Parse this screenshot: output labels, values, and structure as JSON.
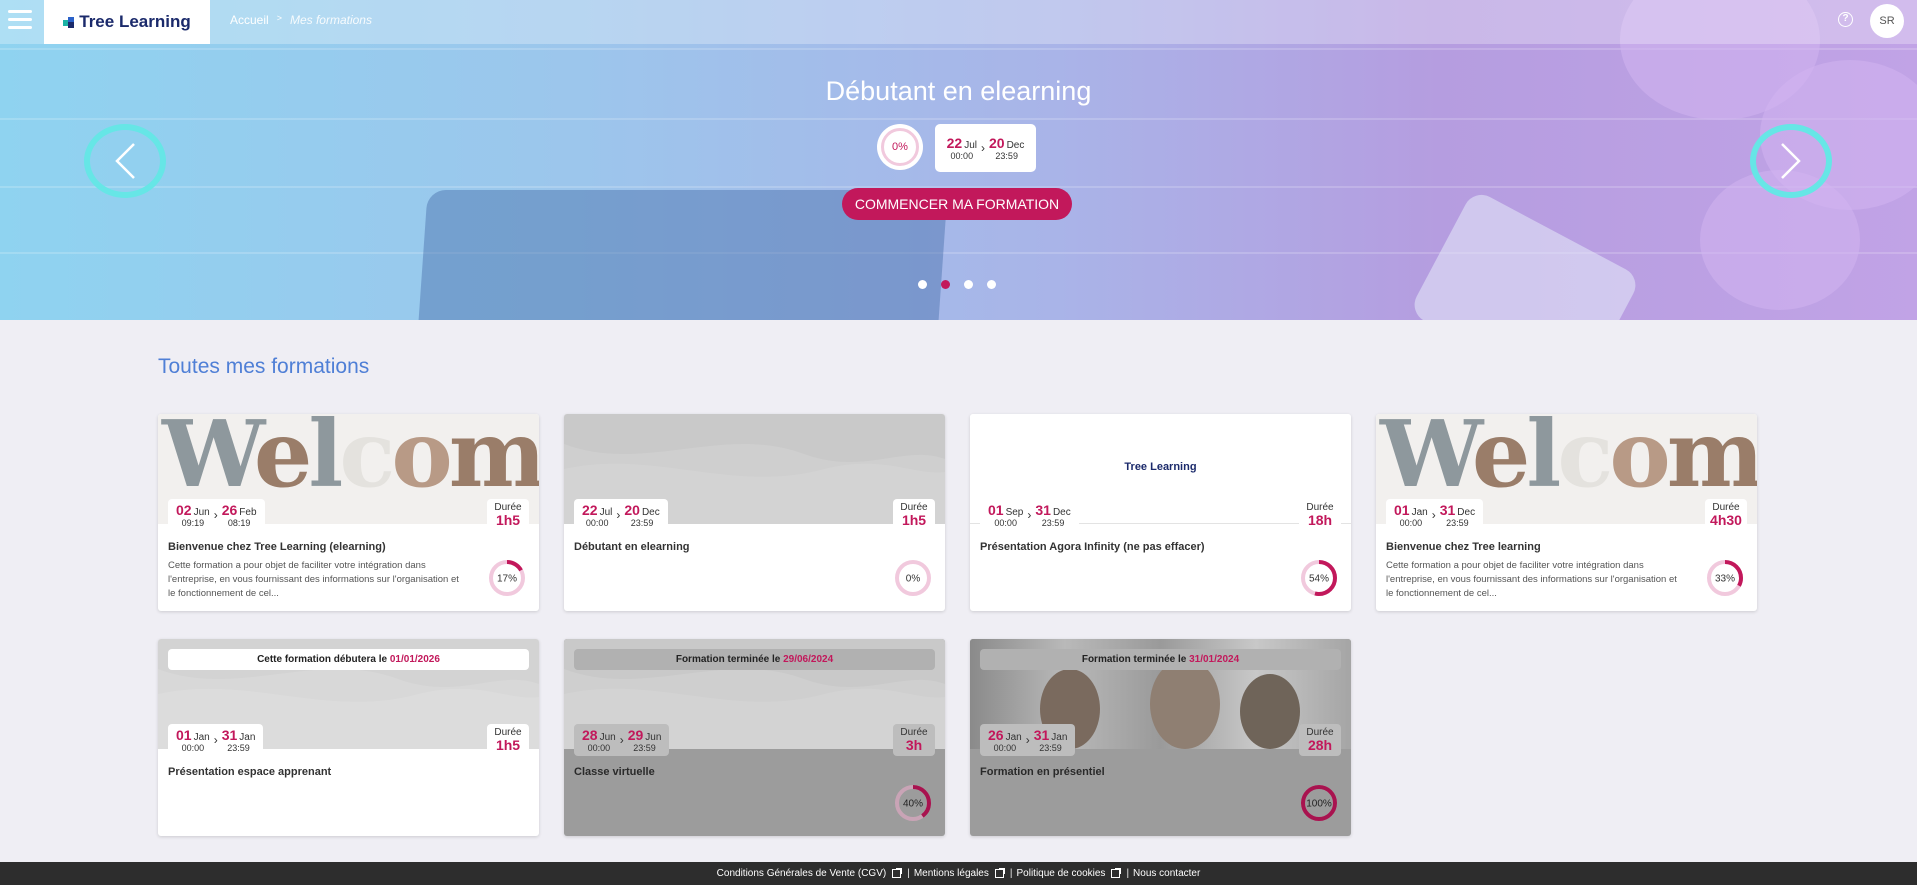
{
  "header": {
    "brand": "Tree Learning",
    "breadcrumb": [
      "Accueil",
      "Mes formations"
    ],
    "breadcrumb_sep": ">",
    "avatar": "SR",
    "help": "?"
  },
  "hero": {
    "title": "Débutant en elearning",
    "progress": "0%",
    "start": {
      "day": "22",
      "month": "Jul",
      "time": "00:00"
    },
    "end": {
      "day": "20",
      "month": "Dec",
      "time": "23:59"
    },
    "cta_label": "COMMENCER MA FORMATION",
    "slides": 4,
    "active_slide": 2
  },
  "section_title": "Toutes mes formations",
  "labels": {
    "duration": "Durée",
    "starts_prefix": "Cette formation débutera le",
    "ended_prefix": "Formation terminée le"
  },
  "cards": [
    {
      "title": "Bienvenue chez Tree Learning (elearning)",
      "image": "welcome",
      "start": {
        "day": "02",
        "month": "Jun",
        "time": "09:19"
      },
      "end": {
        "day": "26",
        "month": "Feb",
        "time": "08:19"
      },
      "duration": "1h5",
      "progress_label": "17%",
      "progress": 0.17,
      "description": "Cette formation a pour objet de faciliter votre intégration dans l'entreprise, en vous fournissant des informations sur l'organisation et le fonctionnement de cel...",
      "banner_date": "",
      "state": "active"
    },
    {
      "title": "Débutant en elearning",
      "image": "wave",
      "start": {
        "day": "22",
        "month": "Jul",
        "time": "00:00"
      },
      "end": {
        "day": "20",
        "month": "Dec",
        "time": "23:59"
      },
      "duration": "1h5",
      "progress_label": "0%",
      "progress": 0,
      "description": "",
      "banner_date": "",
      "state": "active"
    },
    {
      "title": "Présentation Agora Infinity (ne pas effacer)",
      "image": "logo",
      "image_text": "Tree Learning",
      "start": {
        "day": "01",
        "month": "Sep",
        "time": "00:00"
      },
      "end": {
        "day": "31",
        "month": "Dec",
        "time": "23:59"
      },
      "duration": "18h",
      "progress_label": "54%",
      "progress": 0.54,
      "description": "",
      "banner_date": "",
      "state": "active"
    },
    {
      "title": "Bienvenue chez Tree learning",
      "image": "welcome",
      "start": {
        "day": "01",
        "month": "Jan",
        "time": "00:00"
      },
      "end": {
        "day": "31",
        "month": "Dec",
        "time": "23:59"
      },
      "duration": "4h30",
      "progress_label": "33%",
      "progress": 0.33,
      "description": "Cette formation a pour objet de faciliter votre intégration dans l'entreprise, en vous fournissant des informations sur l'organisation et le fonctionnement de cel...",
      "banner_date": "",
      "state": "active"
    },
    {
      "title": "Présentation espace apprenant",
      "image": "wave",
      "start": {
        "day": "01",
        "month": "Jan",
        "time": "00:00"
      },
      "end": {
        "day": "31",
        "month": "Jan",
        "time": "23:59"
      },
      "duration": "1h5",
      "progress_label": "",
      "progress": null,
      "description": "",
      "banner_date": "01/01/2026",
      "state": "upcoming"
    },
    {
      "title": "Classe virtuelle",
      "image": "wave",
      "start": {
        "day": "28",
        "month": "Jun",
        "time": "00:00"
      },
      "end": {
        "day": "29",
        "month": "Jun",
        "time": "23:59"
      },
      "duration": "3h",
      "progress_label": "40%",
      "progress": 0.4,
      "description": "",
      "banner_date": "29/06/2024",
      "state": "ended"
    },
    {
      "title": "Formation en présentiel",
      "image": "people",
      "start": {
        "day": "26",
        "month": "Jan",
        "time": "00:00"
      },
      "end": {
        "day": "31",
        "month": "Jan",
        "time": "23:59"
      },
      "duration": "28h",
      "progress_label": "100%",
      "progress": 1,
      "description": "",
      "banner_date": "31/01/2024",
      "state": "ended"
    }
  ],
  "footer": {
    "links": [
      "Conditions Générales de Vente (CGV)",
      "Mentions légales",
      "Politique de cookies",
      "Nous contacter"
    ]
  },
  "colors": {
    "accent": "#c2185b",
    "title_blue": "#4f7fd6",
    "arrow_cyan": "#66e6e6",
    "brand_navy": "#1b2a6b"
  }
}
